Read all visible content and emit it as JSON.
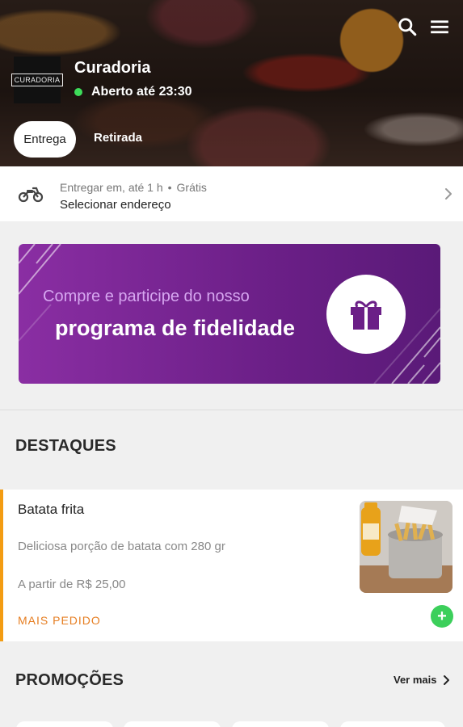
{
  "header": {
    "search_icon": "search-icon",
    "menu_icon": "hamburger-menu-icon"
  },
  "store": {
    "logo_text": "CURADORIA",
    "name": "Curadoria",
    "status": "Aberto até 23:30",
    "status_color": "#3ddc5a"
  },
  "tabs": {
    "delivery": "Entrega",
    "pickup": "Retirada"
  },
  "delivery": {
    "info_prefix": "Entregar em, até 1 h",
    "separator": "•",
    "fee": "Grátis",
    "address": "Selecionar endereço"
  },
  "loyalty": {
    "line1": "Compre e participe do nosso",
    "line2": "programa de fidelidade",
    "colors": {
      "start": "#8a2ea3",
      "end": "#5a1a78"
    }
  },
  "highlights": {
    "title": "DESTAQUES",
    "product": {
      "name": "Batata frita",
      "description": "Deliciosa porção de batata com 280 gr",
      "price_prefix": "A partir de",
      "price": "R$ 25,00",
      "tag": "MAIS PEDIDO",
      "tag_color": "#e67e22"
    }
  },
  "promotions": {
    "title": "PROMOÇÕES",
    "see_more": "Ver mais"
  }
}
